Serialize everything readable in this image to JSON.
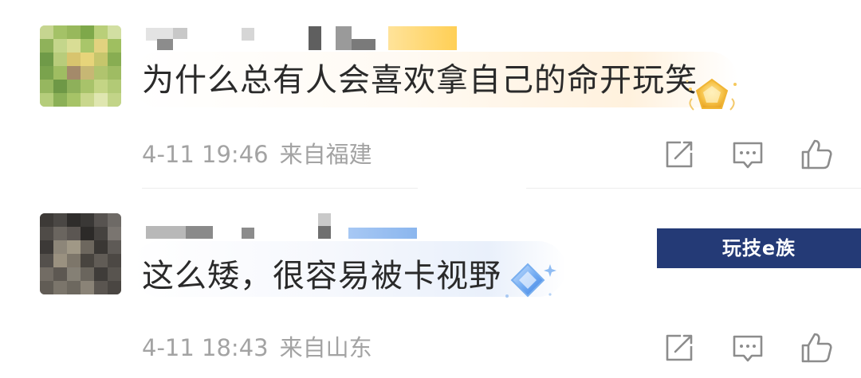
{
  "comments": [
    {
      "text": "为什么总有人会喜欢拿自己的命开玩笑",
      "time": "4-11 19:46",
      "location": "来自福建",
      "badge_color": "#f5b93a"
    },
    {
      "text": "这么矮，很容易被卡视野",
      "time": "4-11 18:43",
      "location": "来自山东",
      "badge_color": "#6aa6ef"
    }
  ],
  "actions": {
    "share_icon": "share-icon",
    "reply_icon": "comment-icon",
    "like_icon": "thumbs-up-icon"
  },
  "watermark": {
    "text": "玩技e族"
  },
  "colors": {
    "text": "#2a2a2a",
    "meta": "#a3a3a3",
    "icon": "#8c8c8c",
    "watermark_bg": "#243a76"
  }
}
